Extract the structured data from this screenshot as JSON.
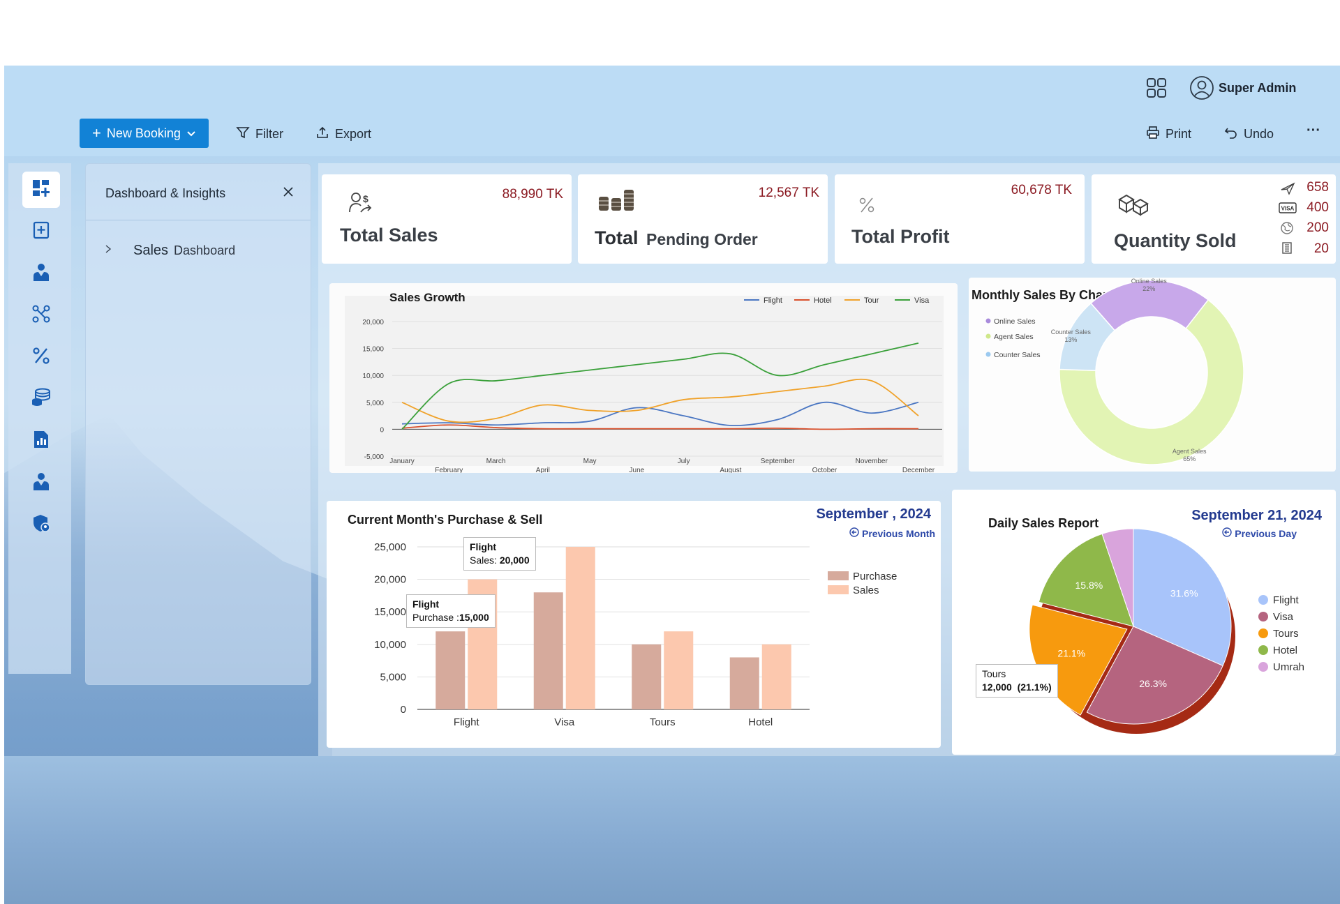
{
  "header": {
    "user_name": "Super Admin"
  },
  "toolbar": {
    "new_booking": "New Booking",
    "filter": "Filter",
    "export": "Export",
    "print": "Print",
    "undo": "Undo",
    "more": "···"
  },
  "panel": {
    "title": "Dashboard & Insights",
    "item_word1": "Sales",
    "item_word2": "Dashboard"
  },
  "kpis": {
    "total_sales": {
      "title": "Total Sales",
      "value": "88,990 TK"
    },
    "pending": {
      "title_bold": "Total",
      "title_rest": "Pending Order",
      "value": "12,567 TK"
    },
    "profit": {
      "title": "Total Profit",
      "value": "60,678 TK"
    },
    "quantity": {
      "title": "Quantity Sold",
      "flight": "658",
      "visa": "400",
      "tour": "200",
      "hotel": "20"
    }
  },
  "sales_growth": {
    "title": "Sales Growth"
  },
  "monthly_channel": {
    "title": "Monthly Sales By Channel"
  },
  "purchase_sell": {
    "title": "Current Month's Purchase & Sell",
    "period": "September , 2024",
    "prev_link": "Previous Month",
    "tooltip1": {
      "cat": "Flight",
      "label": "Sales:",
      "value": "20,000"
    },
    "tooltip2": {
      "cat": "Flight",
      "label": "Purchase :",
      "value": "15,000"
    }
  },
  "daily": {
    "title": "Daily Sales Report",
    "date": "September 21, 2024",
    "prev_link": "Previous Day",
    "tooltip": {
      "label": "Tours",
      "value": "12,000  (21.1%)"
    }
  },
  "chart_data": [
    {
      "type": "line",
      "title": "Sales Growth",
      "x": [
        "January",
        "February",
        "March",
        "April",
        "May",
        "June",
        "July",
        "August",
        "September",
        "October",
        "November",
        "December"
      ],
      "ylim": [
        -5000,
        20000
      ],
      "yticks": [
        "20,000",
        "15,000",
        "10,000",
        "5,000",
        "0",
        "-5,000"
      ],
      "legend_position": "top-right",
      "grid": true,
      "series": [
        {
          "name": "Flight",
          "color": "#4a76c2",
          "values": [
            1000,
            1200,
            800,
            1200,
            1500,
            4000,
            2500,
            700,
            1800,
            5000,
            3000,
            5000
          ]
        },
        {
          "name": "Hotel",
          "color": "#d9502c",
          "values": [
            200,
            800,
            300,
            100,
            100,
            100,
            100,
            100,
            200,
            0,
            100,
            100
          ]
        },
        {
          "name": "Tour",
          "color": "#f0a22a",
          "values": [
            5000,
            1500,
            2000,
            4500,
            3500,
            3500,
            5500,
            6000,
            7000,
            8000,
            9000,
            2500
          ]
        },
        {
          "name": "Visa",
          "color": "#3aa03a",
          "values": [
            0,
            8500,
            9000,
            10000,
            11000,
            12000,
            13000,
            14000,
            10000,
            12000,
            14000,
            16000
          ]
        }
      ]
    },
    {
      "type": "pie",
      "title": "Monthly Sales By Channel",
      "slices": [
        {
          "label": "Online Sales",
          "value": 22,
          "display": "22%",
          "color": "#c8a8ea"
        },
        {
          "label": "Agent Sales",
          "value": 65,
          "display": "65%",
          "color": "#e2f4b4"
        },
        {
          "label": "Counter Sales",
          "value": 13,
          "display": "13%",
          "color": "#cde4f5"
        }
      ],
      "legend_position": "left"
    },
    {
      "type": "bar",
      "title": "Current Month's Purchase & Sell",
      "categories": [
        "Flight",
        "Visa",
        "Tours",
        "Hotel"
      ],
      "ylim": [
        0,
        25000
      ],
      "yticks": [
        "0",
        "5,000",
        "10,000",
        "15,000",
        "20,000",
        "25,000"
      ],
      "legend_position": "right",
      "series": [
        {
          "name": "Purchase",
          "color": "#d6aa9c",
          "values": [
            12000,
            18000,
            10000,
            8000
          ]
        },
        {
          "name": "Sales",
          "color": "#fcc8ae",
          "values": [
            20000,
            25000,
            12000,
            10000
          ]
        }
      ]
    },
    {
      "type": "pie",
      "title": "Daily Sales Report",
      "slices": [
        {
          "label": "Flight",
          "value": 31.6,
          "display": "31.6%",
          "color": "#a8c4fa"
        },
        {
          "label": "Visa",
          "value": 26.3,
          "display": "26.3%",
          "color": "#b5647f"
        },
        {
          "label": "Tours",
          "value": 21.1,
          "display": "21.1%",
          "color": "#f79a0e"
        },
        {
          "label": "Hotel",
          "value": 15.8,
          "display": "15.8%",
          "color": "#8fb84a"
        },
        {
          "label": "Umrah",
          "value": 5.2,
          "display": "",
          "color": "#d9a4dc"
        }
      ],
      "legend_position": "right"
    }
  ]
}
